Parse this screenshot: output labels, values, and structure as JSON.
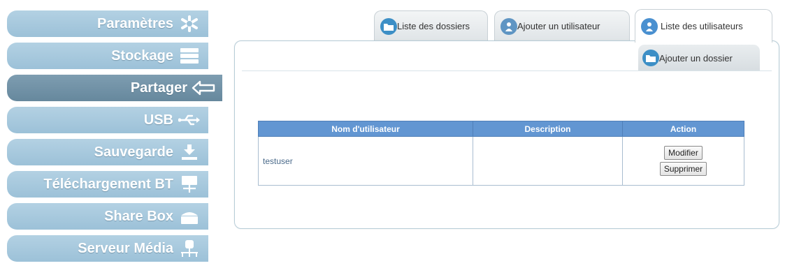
{
  "sidebar": {
    "items": [
      {
        "label": "Paramètres",
        "icon": "gear-icon"
      },
      {
        "label": "Stockage",
        "icon": "storage-icon"
      },
      {
        "label": "Partager",
        "icon": "share-arrow-icon",
        "active": true
      },
      {
        "label": "USB",
        "icon": "usb-icon"
      },
      {
        "label": "Sauvegarde",
        "icon": "download-icon"
      },
      {
        "label": "Téléchargement BT",
        "icon": "bittorrent-icon"
      },
      {
        "label": "Share Box",
        "icon": "share-box-icon"
      },
      {
        "label": "Serveur Média",
        "icon": "media-server-icon"
      }
    ]
  },
  "tabs": [
    {
      "label": "Liste des dossiers",
      "icon": "folder-icon"
    },
    {
      "label": "Ajouter un utilisateur",
      "icon": "add-user-icon"
    },
    {
      "label": "Liste des utilisateurs",
      "icon": "user-list-icon",
      "active": true
    }
  ],
  "panel": {
    "subtab": {
      "label": "Ajouter un dossier",
      "icon": "add-folder-icon"
    }
  },
  "table": {
    "headers": [
      "Nom d'utilisateur",
      "Description",
      "Action"
    ],
    "rows": [
      {
        "name": "testuser",
        "description": ""
      }
    ],
    "actions": {
      "modify": "Modifier",
      "delete": "Supprimer"
    }
  },
  "colors": {
    "sidebar": "#a9cade",
    "sidebar_active": "#728fa3",
    "table_header": "#6296d2",
    "panel_border": "#b7cdd8"
  }
}
